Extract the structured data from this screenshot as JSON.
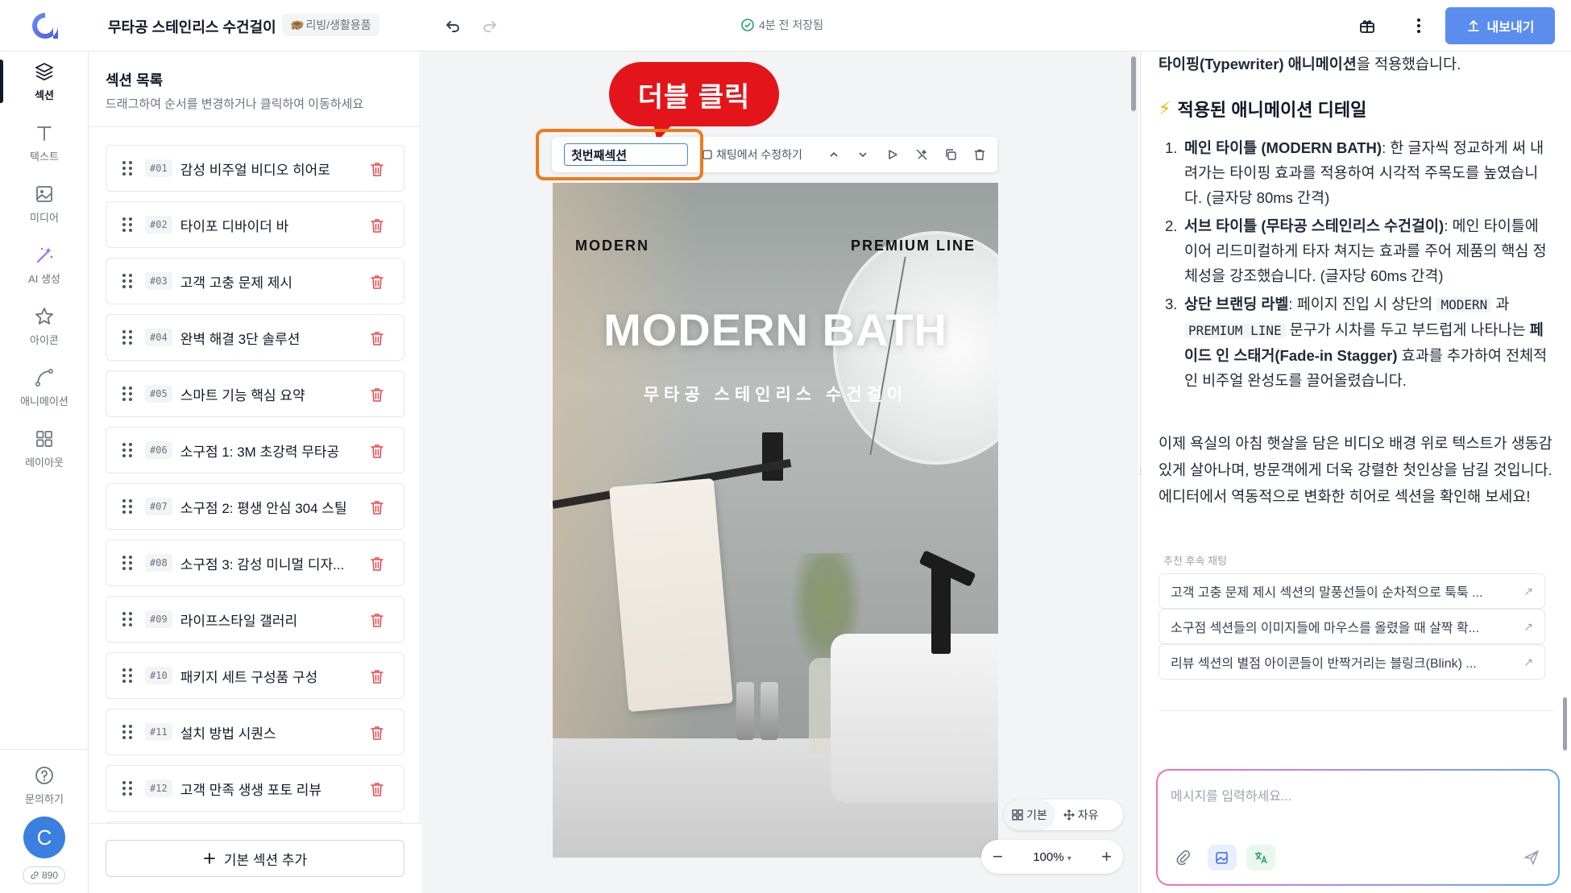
{
  "app": {
    "doc_title": "무타공 스테인리스 수건걸이",
    "category": "리빙/생활용품",
    "category_emoji": "🪹",
    "save_status": "4분 전 저장됨",
    "export_label": "내보내기"
  },
  "rail": {
    "items": [
      {
        "label": "섹션",
        "icon": "layers-icon"
      },
      {
        "label": "텍스트",
        "icon": "text-icon"
      },
      {
        "label": "미디어",
        "icon": "image-icon"
      },
      {
        "label": "AI 생성",
        "icon": "magic-wand-icon"
      },
      {
        "label": "아이콘",
        "icon": "star-icon"
      },
      {
        "label": "애니메이션",
        "icon": "curve-icon"
      },
      {
        "label": "레이아웃",
        "icon": "grid-icon"
      }
    ],
    "help_label": "문의하기",
    "avatar_letter": "C",
    "credits": "890"
  },
  "sections_panel": {
    "title": "섹션 목록",
    "subtitle": "드래그하여 순서를 변경하거나 클릭하여 이동하세요",
    "items": [
      {
        "num": "#01",
        "name": "감성 비주얼 비디오 히어로"
      },
      {
        "num": "#02",
        "name": "타이포 디바이더 바"
      },
      {
        "num": "#03",
        "name": "고객 고충 문제 제시"
      },
      {
        "num": "#04",
        "name": "완벽 해결 3단 솔루션"
      },
      {
        "num": "#05",
        "name": "스마트 기능 핵심 요약"
      },
      {
        "num": "#06",
        "name": "소구점 1: 3M 초강력 무타공"
      },
      {
        "num": "#07",
        "name": "소구점 2: 평생 안심 304 스틸"
      },
      {
        "num": "#08",
        "name": "소구점 3: 감성 미니멀 디자..."
      },
      {
        "num": "#09",
        "name": "라이프스타일 갤러리"
      },
      {
        "num": "#10",
        "name": "패키지 세트 구성품 구성"
      },
      {
        "num": "#11",
        "name": "설치 방법 시퀀스"
      },
      {
        "num": "#12",
        "name": "고객 만족 생생 포토 리뷰"
      }
    ],
    "add_label": "기본 섹션 추가"
  },
  "canvas": {
    "callout": "더블 클릭",
    "section_name_prefix": "첫번째 ",
    "section_name_editing": "섹션",
    "chat_edit_label": "채팅에서 수정하기",
    "hero": {
      "label_left": "MODERN",
      "label_right": "PREMIUM LINE",
      "title": "MODERN BATH",
      "subtitle": "무타공 스테인리스 수건걸이"
    },
    "mode_basic": "기본",
    "mode_free": "자유",
    "zoom_level": "100%"
  },
  "chat": {
    "intro_bold": "타이핑(Typewriter) 애니메이션",
    "intro_rest": "을 적용했습니다.",
    "heading": "적용된 애니메이션 디테일",
    "items": [
      {
        "n": "1.",
        "bold": "메인 타이틀 (MODERN BATH)",
        "text": ": 한 글자씩 정교하게 써 내려가는 타이핑 효과를 적용하여 시각적 주목도를 높였습니다. (글자당 80ms 간격)"
      },
      {
        "n": "2.",
        "bold": "서브 타이틀 (무타공 스테인리스 수건걸이)",
        "text": ": 메인 타이틀에 이어 리드미컬하게 타자 쳐지는 효과를 주어 제품의 핵심 정체성을 강조했습니다. (글자당 60ms 간격)"
      }
    ],
    "item3": {
      "n": "3.",
      "bold": "상단 브랜딩 라벨",
      "t1": ": 페이지 진입 시 상단의 ",
      "code1": "MODERN",
      "t2": " 과 ",
      "code2": "PREMIUM LINE",
      "t3": " 문구가 시차를 두고 부드럽게 나타나는 ",
      "bold2": "페이드 인 스태거(Fade-in Stagger)",
      "t4": " 효과를 추가하여 전체적인 비주얼 완성도를 끌어올렸습니다."
    },
    "closing": "이제 욕실의 아침 햇살을 담은 비디오 배경 위로 텍스트가 생동감 있게 살아나며, 방문객에게 더욱 강렬한 첫인상을 남길 것입니다. 에디터에서 역동적으로 변화한 히어로 섹션을 확인해 보세요!",
    "suggest_label": "추천 후속 채팅",
    "suggestions": [
      "고객 고충 문제 제시 섹션의 말풍선들이 순차적으로 툭툭 ...",
      "소구점 섹션들의 이미지들에 마우스를 올렸을 때 살짝 확...",
      "리뷰 섹션의 별점 아이콘들이 반짝거리는 블링크(Blink) ..."
    ],
    "input_placeholder": "메시지를 입력하세요..."
  },
  "colors": {
    "accent": "#5b8def",
    "callout": "#e3151a",
    "highlight_border": "#f07a1a",
    "delete": "#e5484d"
  }
}
